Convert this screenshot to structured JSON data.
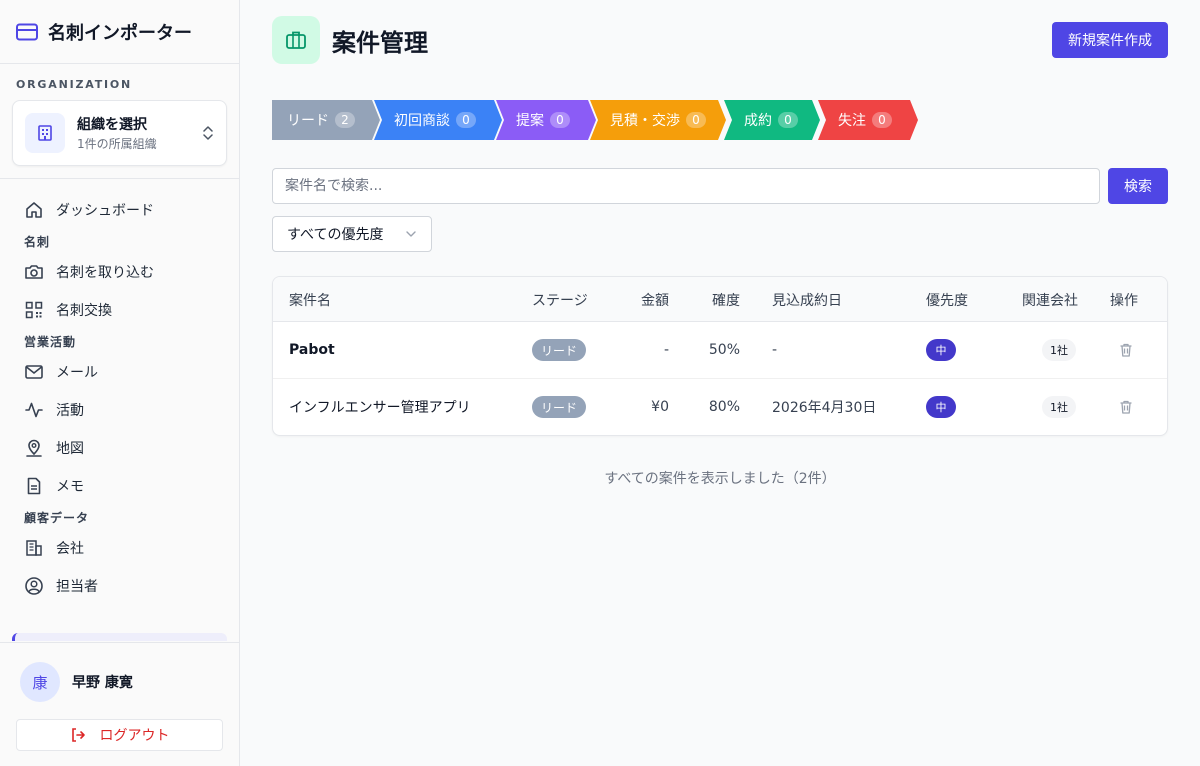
{
  "app": {
    "title": "名刺インポーター"
  },
  "organization": {
    "section_label": "ORGANIZATION",
    "selector_title": "組織を選択",
    "selector_sub": "1件の所属組織"
  },
  "nav": {
    "dashboard": "ダッシュボード",
    "group_meishi": "名刺",
    "import": "名刺を取り込む",
    "exchange": "名刺交換",
    "group_sales": "営業活動",
    "mail": "メール",
    "activity": "活動",
    "map": "地図",
    "memo": "メモ",
    "group_customer": "顧客データ",
    "company": "会社",
    "contact": "担当者"
  },
  "user": {
    "avatar_char": "康",
    "name": "早野 康寛",
    "logout_label": "ログアウト"
  },
  "page": {
    "title": "案件管理",
    "new_button": "新規案件作成",
    "accent_color": "#4f46e5"
  },
  "pipeline": [
    {
      "label": "リード",
      "count": "2",
      "color": "#94a3b8"
    },
    {
      "label": "初回商談",
      "count": "0",
      "color": "#3b82f6"
    },
    {
      "label": "提案",
      "count": "0",
      "color": "#8b5cf6"
    },
    {
      "label": "見積・交渉",
      "count": "0",
      "color": "#f59e0b"
    },
    {
      "label": "成約",
      "count": "0",
      "color": "#10b981"
    },
    {
      "label": "失注",
      "count": "0",
      "color": "#ef4444"
    }
  ],
  "search": {
    "placeholder": "案件名で検索...",
    "button": "検索"
  },
  "filter": {
    "priority_value": "すべての優先度"
  },
  "table": {
    "headers": {
      "name": "案件名",
      "stage": "ステージ",
      "amount": "金額",
      "probability": "確度",
      "close_date": "見込成約日",
      "priority": "優先度",
      "companies": "関連会社",
      "actions": "操作"
    },
    "rows": [
      {
        "name": "Pabot",
        "stage": "リード",
        "amount": "-",
        "probability": "50%",
        "close_date": "-",
        "priority": "中",
        "companies": "1社"
      },
      {
        "name": "インフルエンサー管理アプリ",
        "stage": "リード",
        "amount": "¥0",
        "probability": "80%",
        "close_date": "2026年4月30日",
        "priority": "中",
        "companies": "1社"
      }
    ]
  },
  "footer_note": "すべての案件を表示しました（2件）"
}
